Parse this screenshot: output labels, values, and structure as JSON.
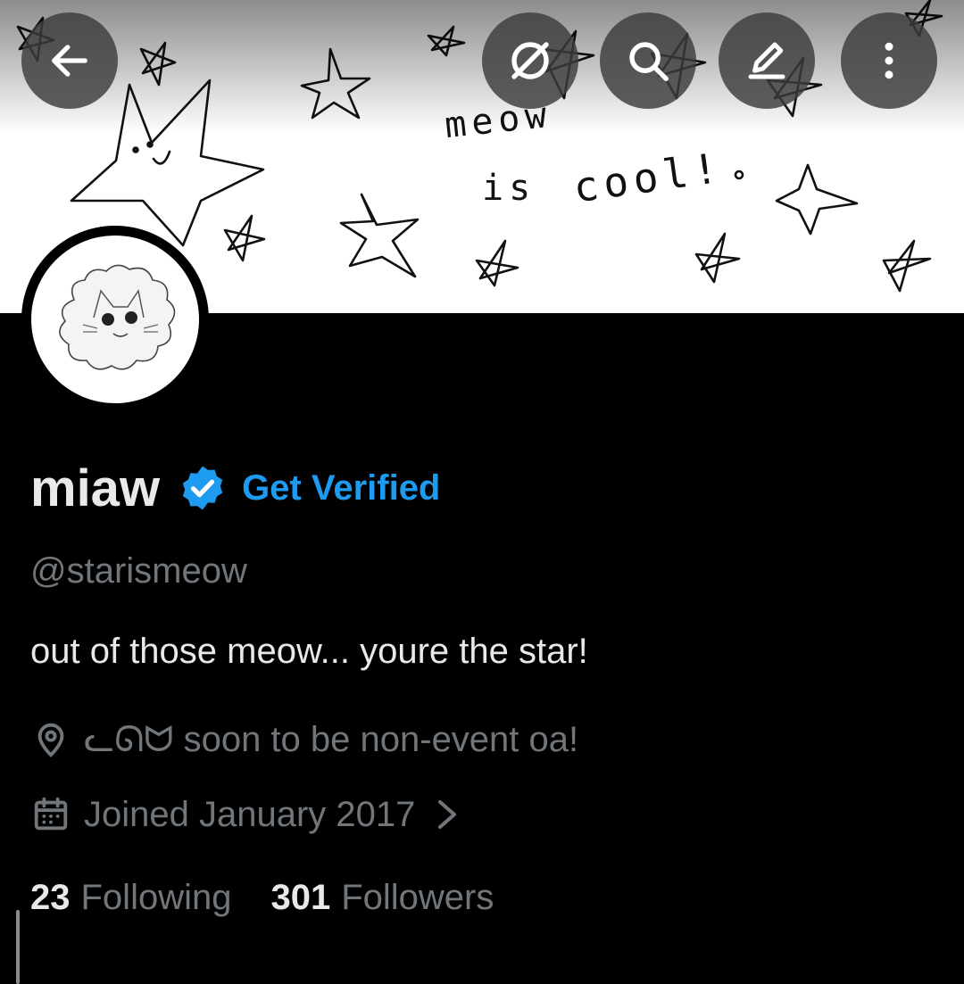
{
  "banner": {
    "handwriting": [
      "meow",
      "is",
      "cool!"
    ]
  },
  "topbar": {
    "icons": [
      "back-arrow-icon",
      "grok-icon",
      "search-icon",
      "edit-icon",
      "more-vertical-icon"
    ]
  },
  "profile": {
    "display_name": "miaw",
    "verified_badge_icon": "verified-badge-icon",
    "get_verified_label": "Get Verified",
    "handle": "@starismeow",
    "bio": "out of those meow... youre the star!",
    "location": "ᓚᘏᗢ soon to be non-event oa!",
    "joined": "Joined January 2017",
    "following_count": "23",
    "following_label": "Following",
    "followers_count": "301",
    "followers_label": "Followers"
  },
  "colors": {
    "background": "#000000",
    "accent": "#1d9bf0",
    "primary_text": "#e7e9ea",
    "secondary_text": "#71767b"
  }
}
